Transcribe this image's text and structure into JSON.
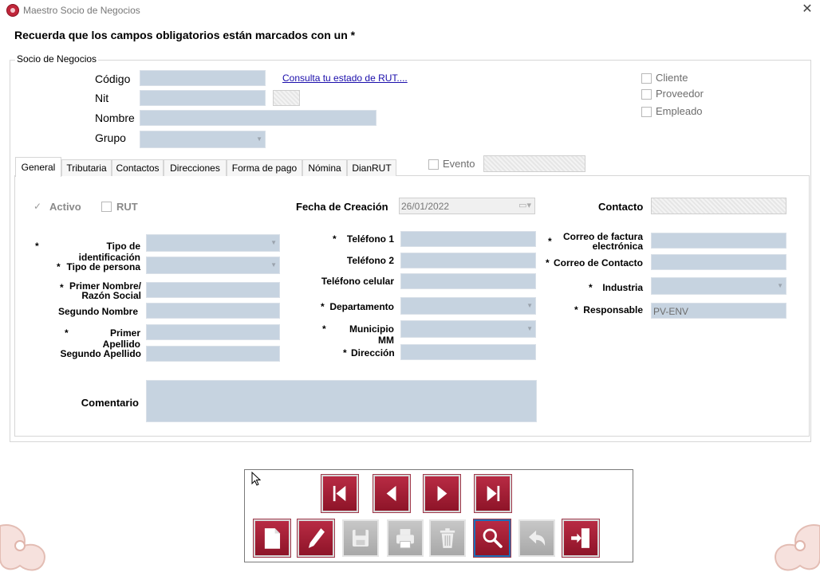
{
  "window": {
    "title": "Maestro Socio de Negocios",
    "close_glyph": "✕"
  },
  "notice": "Recuerda que  los campos obligatorios están marcados con un *",
  "socio": {
    "group_title": "Socio de Negocios",
    "codigo_label": "Código",
    "nit_label": "Nit",
    "nombre_label": "Nombre",
    "grupo_label": "Grupo",
    "rut_link": "Consulta tu estado de RUT....",
    "cliente_label": "Cliente",
    "proveedor_label": "Proveedor",
    "empleado_label": "Empleado"
  },
  "tabs": [
    "General",
    "Tributaria",
    "Contactos",
    "Direcciones",
    "Forma de pago",
    "Nómina",
    "DianRUT"
  ],
  "evento_label": "Evento",
  "general": {
    "activo_label": "Activo",
    "rut_label": "RUT",
    "fecha_creacion_label": "Fecha de Creación",
    "fecha_creacion_value": "26/01/2022",
    "contacto_label": "Contacto",
    "tipo_identificacion_label": "Tipo de identificación",
    "tipo_persona_label": "Tipo de persona",
    "primer_nombre_label_1": "Primer Nombre/",
    "primer_nombre_label_2": "Razón Social",
    "segundo_nombre_label": "Segundo Nombre",
    "primer_apellido_label": "Primer Apellido",
    "segundo_apellido_label": "Segundo Apellido",
    "comentario_label": "Comentario",
    "telefono1_label": "Teléfono 1",
    "telefono2_label": "Teléfono 2",
    "telefono_celular_label": "Teléfono celular",
    "departamento_label": "Departamento",
    "municipio_label": "Municipio MM",
    "direccion_label": "Dirección",
    "correo_factura_label_1": "Correo de factura",
    "correo_factura_label_2": "electrónica",
    "correo_contacto_label": "Correo de Contacto",
    "industria_label": "Industria",
    "responsable_label": "Responsable",
    "responsable_value": "PV-ENV",
    "required_mark": "*"
  },
  "toolbar": {
    "nav": [
      "first-record-icon",
      "previous-record-icon",
      "next-record-icon",
      "last-record-icon"
    ],
    "actions": [
      "new-document-icon",
      "edit-pencil-icon",
      "save-disk-icon",
      "print-icon",
      "delete-trash-icon",
      "search-magnifier-icon",
      "undo-arrow-icon",
      "exit-door-icon"
    ]
  },
  "colors": {
    "accent_red": "#a81e36",
    "field_fill": "#c6d3e0",
    "disabled_gray": "#b4b4b4"
  }
}
